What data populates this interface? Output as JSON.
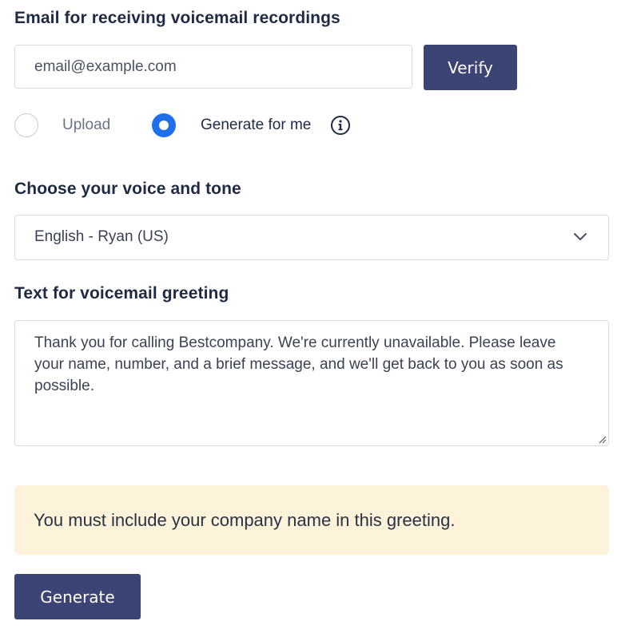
{
  "email_section": {
    "label": "Email for receiving voicemail recordings",
    "input_placeholder": "email@example.com",
    "input_value": "",
    "verify_label": "Verify"
  },
  "source_options": {
    "upload_label": "Upload",
    "generate_label": "Generate for me",
    "selected": "generate",
    "info_icon": "info-icon"
  },
  "voice_section": {
    "label": "Choose your voice and tone",
    "selected_voice": "English - Ryan (US)"
  },
  "greeting_section": {
    "label": "Text for voicemail greeting",
    "text": "Thank you for calling Bestcompany. We're currently unavailable. Please leave your name, number, and a brief message, and we'll get back to you as soon as possible."
  },
  "notice": {
    "text": "You must include your company name in this greeting.",
    "background": "#fdf3db"
  },
  "generate_label": "Generate",
  "colors": {
    "primary_button": "#3b4472",
    "radio_selected": "#1f6feb",
    "heading_text": "#1f2a44"
  }
}
